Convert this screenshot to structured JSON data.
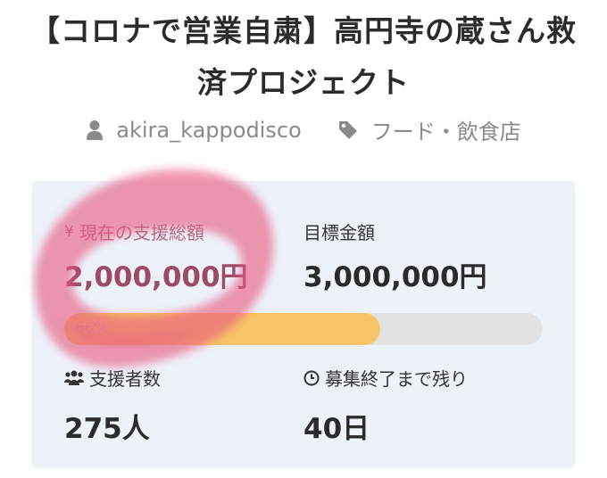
{
  "project": {
    "title_line1": "【コロナで営業自粛】高円寺の蔵さん救",
    "title_line2": "済プロジェクト",
    "owner": "akira_kappodisco",
    "category": "フード・飲食店"
  },
  "stats": {
    "current_icon": "¥",
    "current_label": "現在の支援総額",
    "current_amount": "2,000,000円",
    "goal_label": "目標金額",
    "goal_amount": "3,000,000円",
    "progress_text": "66%",
    "progress_fraction": 0.66,
    "backers_label": "支援者数",
    "backers_count": "275人",
    "remaining_label": "募集終了まで残り",
    "remaining_value": "40日"
  },
  "icons": {
    "owner": "user-icon",
    "category": "tag-icon",
    "backers": "users-icon",
    "remaining": "clock-icon"
  },
  "colors": {
    "progress_fill": "#f7c567",
    "progress_track": "#e2e2e2",
    "card_bg": "#edf2f9",
    "highlight_scribble": "#e8587f"
  }
}
